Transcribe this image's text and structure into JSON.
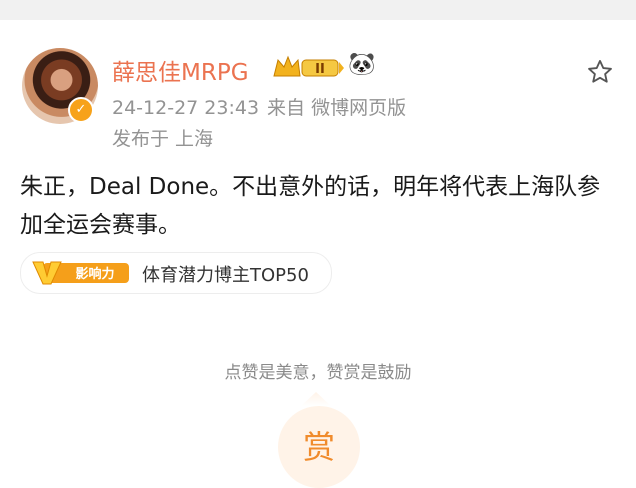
{
  "post": {
    "author_name": "薛思佳MRPG",
    "member_level": "II",
    "timestamp": "24-12-27 23:43",
    "source": "来自 微博网页版",
    "location": "发布于 上海",
    "content": "朱正，Deal Done。不出意外的话，明年将代表上海队参加全运会赛事。"
  },
  "influence": {
    "badge_text": "影响力",
    "badge_letter": "V",
    "label": "体育潜力博主TOP50"
  },
  "reward": {
    "hint": "点赞是美意，赞赏是鼓励",
    "button_label": "赏"
  },
  "colors": {
    "name": "#eb7350",
    "meta": "#939393",
    "accent_orange": "#f7a21a",
    "reward_bg": "#fff3e8",
    "reward_fg": "#f08b2c"
  },
  "icons": {
    "verified": "verified-v-icon",
    "crown": "crown-member-icon",
    "panda": "panda-icon",
    "star": "star-icon"
  }
}
